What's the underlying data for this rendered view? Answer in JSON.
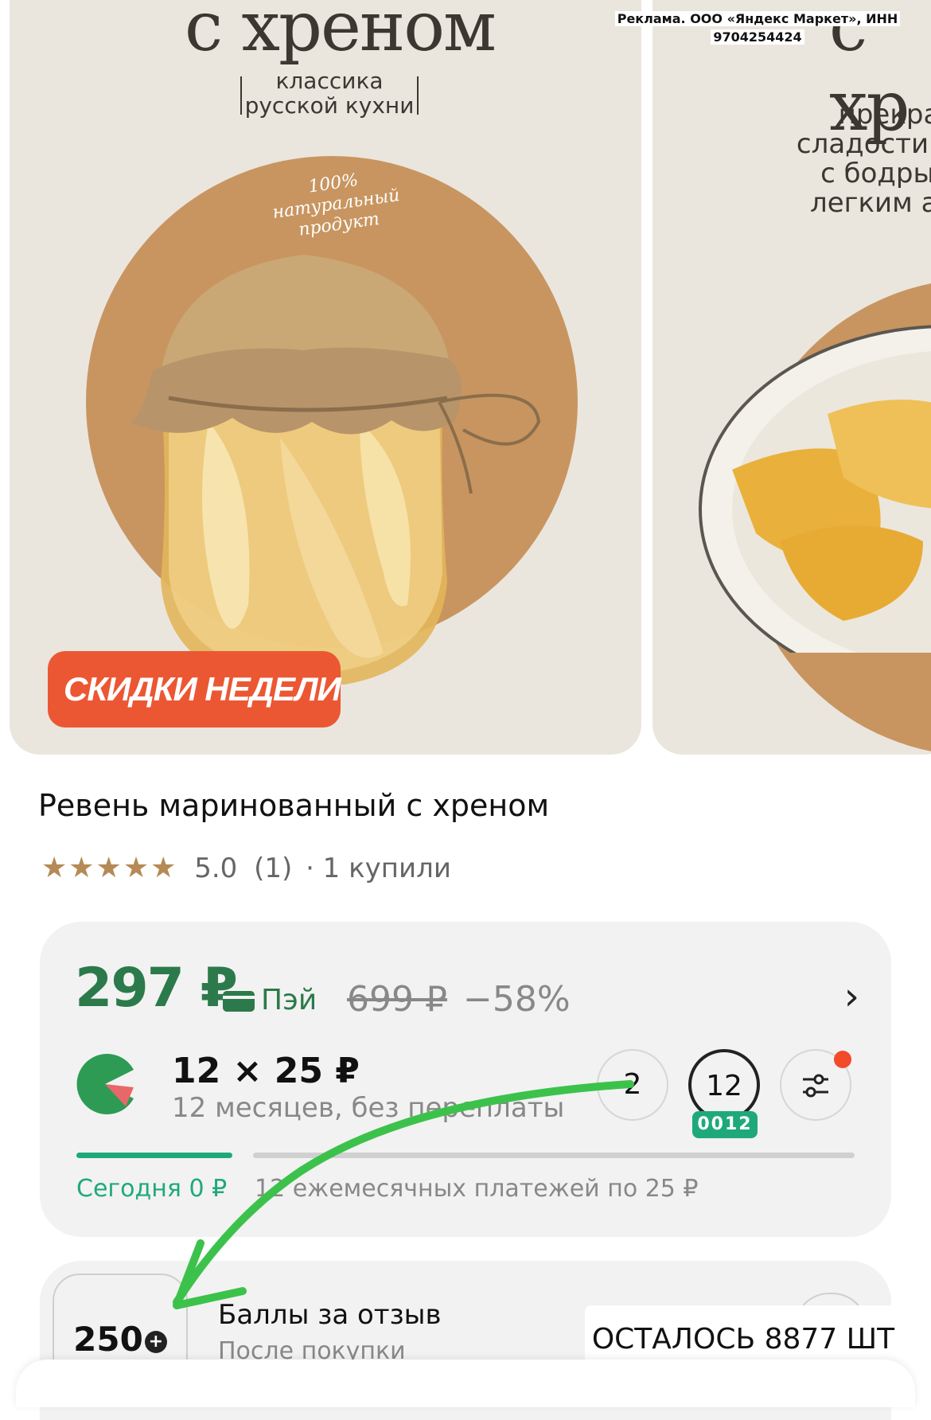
{
  "gallery": {
    "card1": {
      "heading": "с хреном",
      "sub_line1": "классика",
      "sub_line2": "русской кухни",
      "note_line1": "100%",
      "note_line2": "натуральный",
      "note_line3": "продукт",
      "promo_label": "СКИДКИ НЕДЕЛИ",
      "promo_chevron": "›"
    },
    "card2": {
      "heading": "с хр",
      "text_line1": "прекрас",
      "text_line2": "сладости и",
      "text_line3": "с бодрым",
      "text_line4": "легким ар"
    },
    "ad_line1": "Реклама. ООО «Яндекс Маркет», ИНН",
    "ad_line2": "9704254424"
  },
  "product": {
    "title": "Ревень маринованный с хреном",
    "stars": "★★★★★",
    "rating": "5.0",
    "reviews": "(1)",
    "bought": "· 1 купили"
  },
  "price": {
    "current": "297 ₽",
    "pay_label": "Пэй",
    "old": "699 ₽",
    "discount": "−58%",
    "chevron": "›"
  },
  "split": {
    "value": "12 × 25 ₽",
    "description": "12 месяцев, без переплаты",
    "option_2": "2",
    "option_12": "12",
    "option_12_badge": "0012",
    "today": "Сегодня 0 ₽",
    "monthly": "12 ежемесячных платежей по 25 ₽",
    "progress_today": 0.2
  },
  "bonus": {
    "points": "250",
    "title": "Баллы за отзыв",
    "subtitle": "После покупки"
  },
  "overlay": {
    "left_label": "ОСТАЛОСЬ 8877 ШТ"
  },
  "colors": {
    "price_green": "#2c7a4b",
    "promo_red": "#ec5733",
    "accent_green": "#1fa97a",
    "arrow_green": "#3cc24b",
    "card_beige": "#eae6de"
  }
}
